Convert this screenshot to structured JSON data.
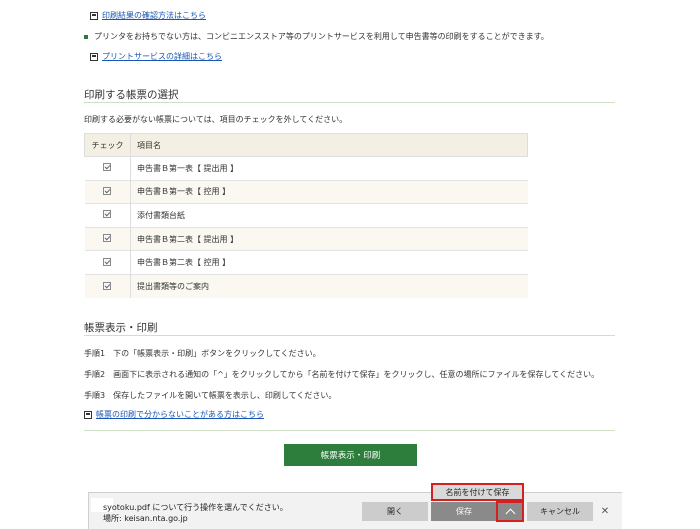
{
  "links": {
    "print_result_check": "印刷結果の確認方法はこちら",
    "print_service_detail": "プリントサービスの詳細はこちら",
    "print_help": "帳票の印刷で分からないことがある方はこちら"
  },
  "notice": "プリンタをお持ちでない方は、コンビニエンスストア等のプリントサービスを利用して申告書等の印刷をすることができます。",
  "selection": {
    "title": "印刷する帳票の選択",
    "description": "印刷する必要がない帳票については、項目のチェックを外してください。",
    "col_check": "チェック",
    "col_item": "項目名",
    "rows": [
      {
        "label": "申告書Ｂ第一表【 提出用 】",
        "checked": true
      },
      {
        "label": "申告書Ｂ第一表【 控用 】",
        "checked": true
      },
      {
        "label": "添付書類台紙",
        "checked": true
      },
      {
        "label": "申告書Ｂ第二表【 提出用 】",
        "checked": true
      },
      {
        "label": "申告書Ｂ第二表【 控用 】",
        "checked": true
      },
      {
        "label": "提出書類等のご案内",
        "checked": true
      }
    ]
  },
  "display_print": {
    "title": "帳票表示・印刷",
    "step1": "手順1　下の「帳票表示・印刷」ボタンをクリックしてください。",
    "step2": "手順2　画面下に表示される通知の「^」をクリックしてから「名前を付けて保存」をクリックし、任意の場所にファイルを保存してください。",
    "step3": "手順3　保存したファイルを開いて帳票を表示し、印刷してください。",
    "button": "帳票表示・印刷"
  },
  "download_bar": {
    "message": "syotoku.pdf について行う操作を選んでください。",
    "location": "場所: keisan.nta.go.jp",
    "open": "開く",
    "save": "保存",
    "cancel": "キャンセル",
    "close": "✕",
    "save_as": "名前を付けて保存"
  },
  "colors": {
    "accent_green": "#2d7d3c",
    "link_blue": "#1a56b3",
    "highlight_red": "#d32020"
  }
}
